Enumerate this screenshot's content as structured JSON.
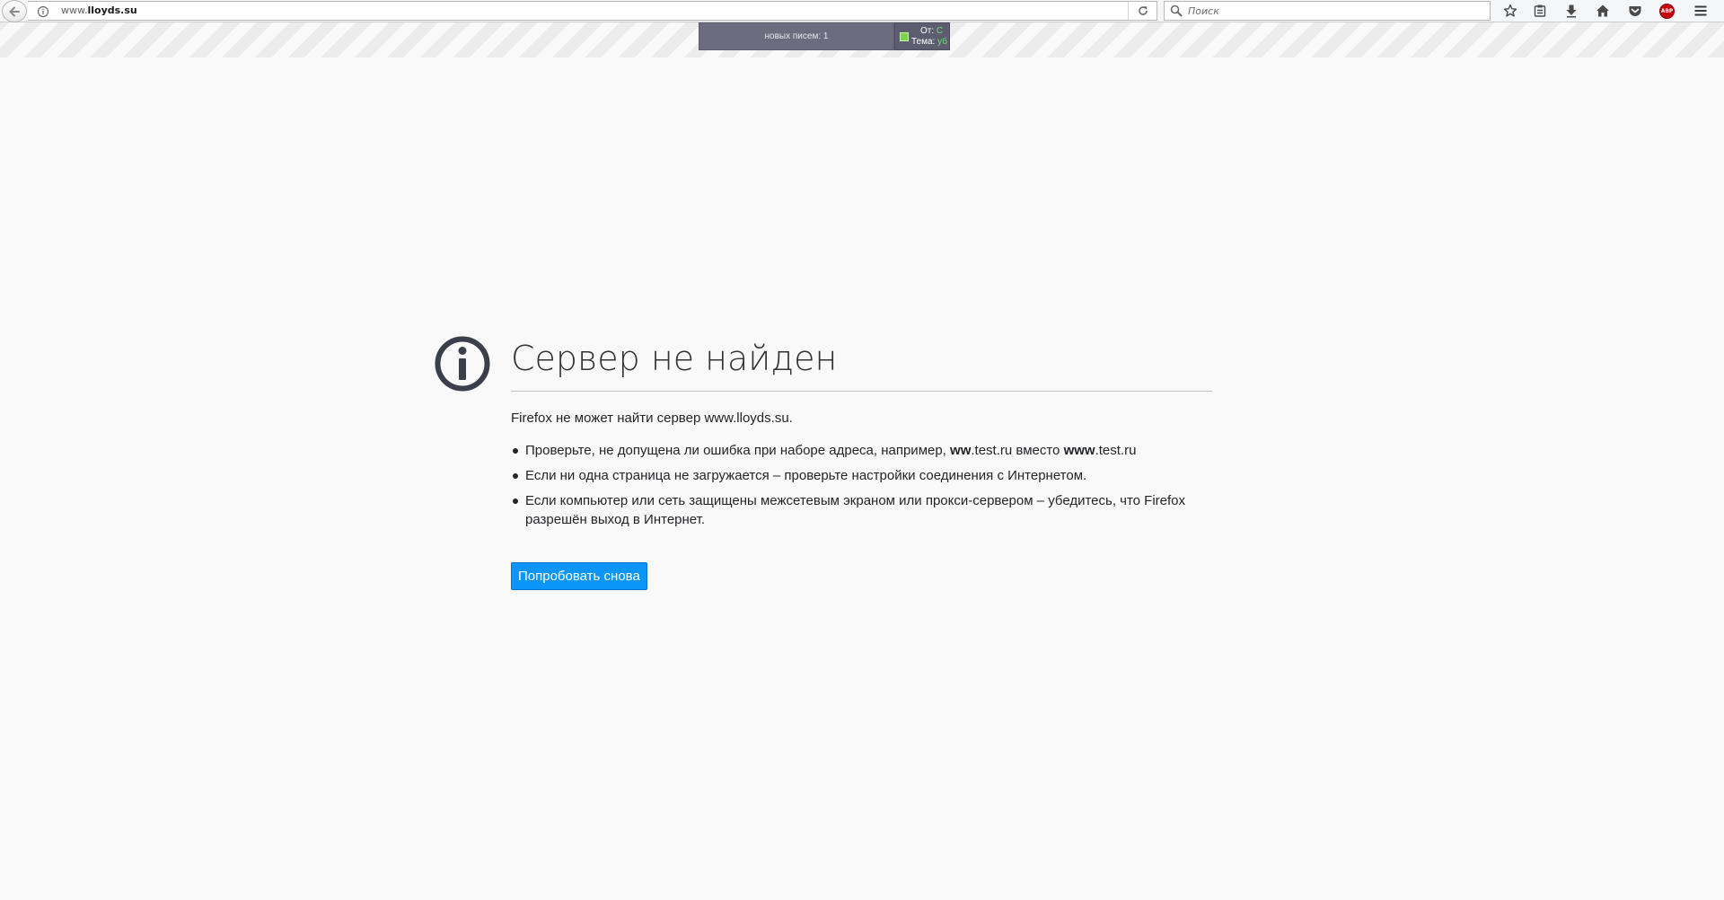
{
  "toolbar": {
    "url_prefix": "www.",
    "url_domain": "lloyds.su",
    "search_placeholder": "Поиск"
  },
  "notifier": {
    "new_mail_text": "новых писем: 1",
    "from_label": "От:",
    "from_value": "C",
    "subject_label": "Тема:",
    "subject_value": "уб"
  },
  "error_page": {
    "title": "Сервер не найден",
    "description": "Firefox не может найти сервер www.lloyds.su.",
    "tip1_start": "Проверьте, не допущена ли ошибка при наборе адреса, например, ",
    "tip1_bold1": "ww",
    "tip1_mid1": ".test.ru вместо ",
    "tip1_bold2": "www",
    "tip1_end": ".test.ru",
    "tip2": "Если ни одна страница не загружается – проверьте настройки соединения с Интернетом.",
    "tip3": "Если компьютер или сеть защищены межсетевым экраном или прокси-сервером – убедитесь, что Firefox разрешён выход в Интернет.",
    "retry_label": "Попробовать снова"
  },
  "icons": {
    "abp_text": "ABP"
  },
  "colors": {
    "accent": "#0996f8",
    "title": "#333333",
    "icon": "#3a3f4b",
    "abp": "#c7040c"
  }
}
